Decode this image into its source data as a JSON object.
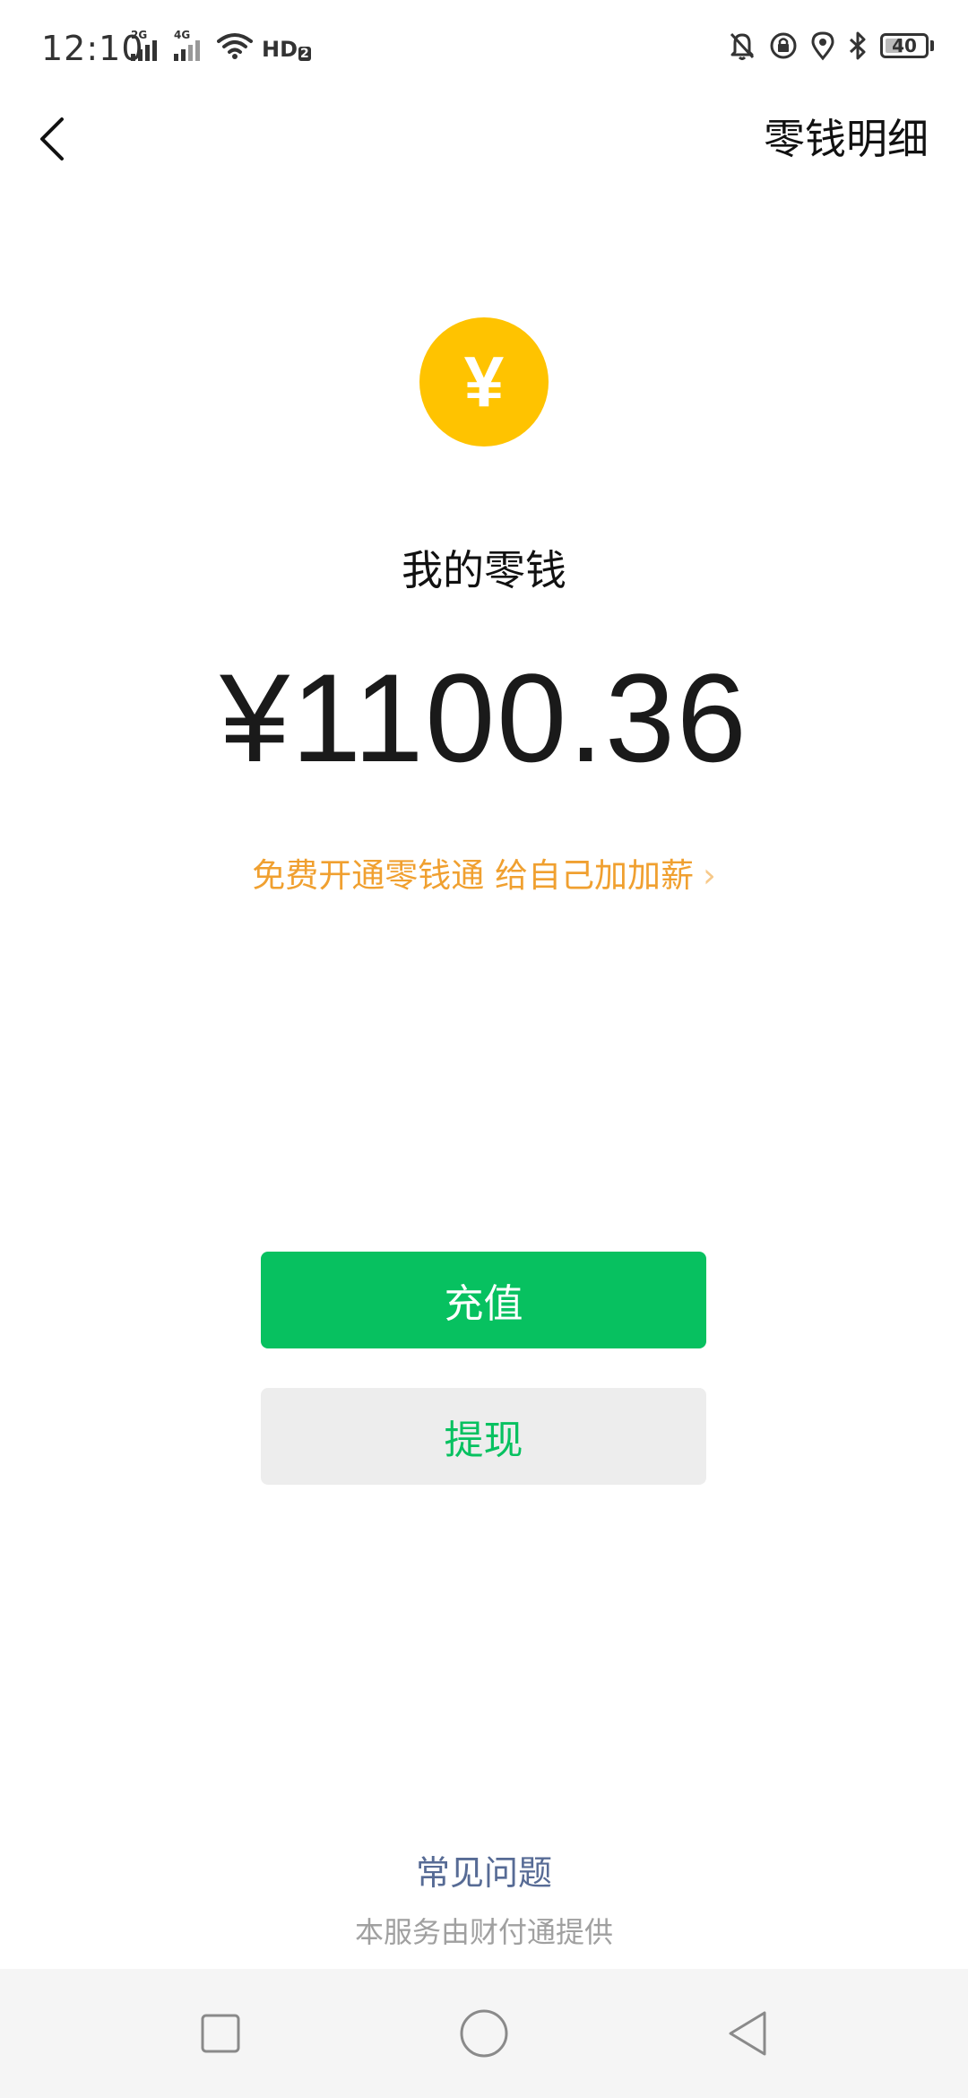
{
  "status_bar": {
    "time": "12:10",
    "signal1_label": "2G",
    "signal2_label": "4G",
    "hd_label": "HD",
    "hd_sub": "2",
    "battery": "40"
  },
  "header": {
    "detail_label": "零钱明细"
  },
  "wallet": {
    "title": "我的零钱",
    "amount": "¥1100.36",
    "promo_text": "免费开通零钱通 给自己加加薪",
    "promo_chevron": "›",
    "coin_symbol": "¥"
  },
  "actions": {
    "recharge_label": "充值",
    "withdraw_label": "提现"
  },
  "footer": {
    "faq_label": "常见问题",
    "provider_text": "本服务由财付通提供"
  },
  "colors": {
    "primary_green": "#07C160",
    "coin_yellow": "#FFC300",
    "promo_orange": "#F0A030",
    "link_blue": "#576B95"
  },
  "icons": {
    "back": "chevron-left-icon",
    "coin": "yuan-coin-icon",
    "nav_recents": "square-icon",
    "nav_home": "circle-icon",
    "nav_back": "triangle-back-icon"
  }
}
